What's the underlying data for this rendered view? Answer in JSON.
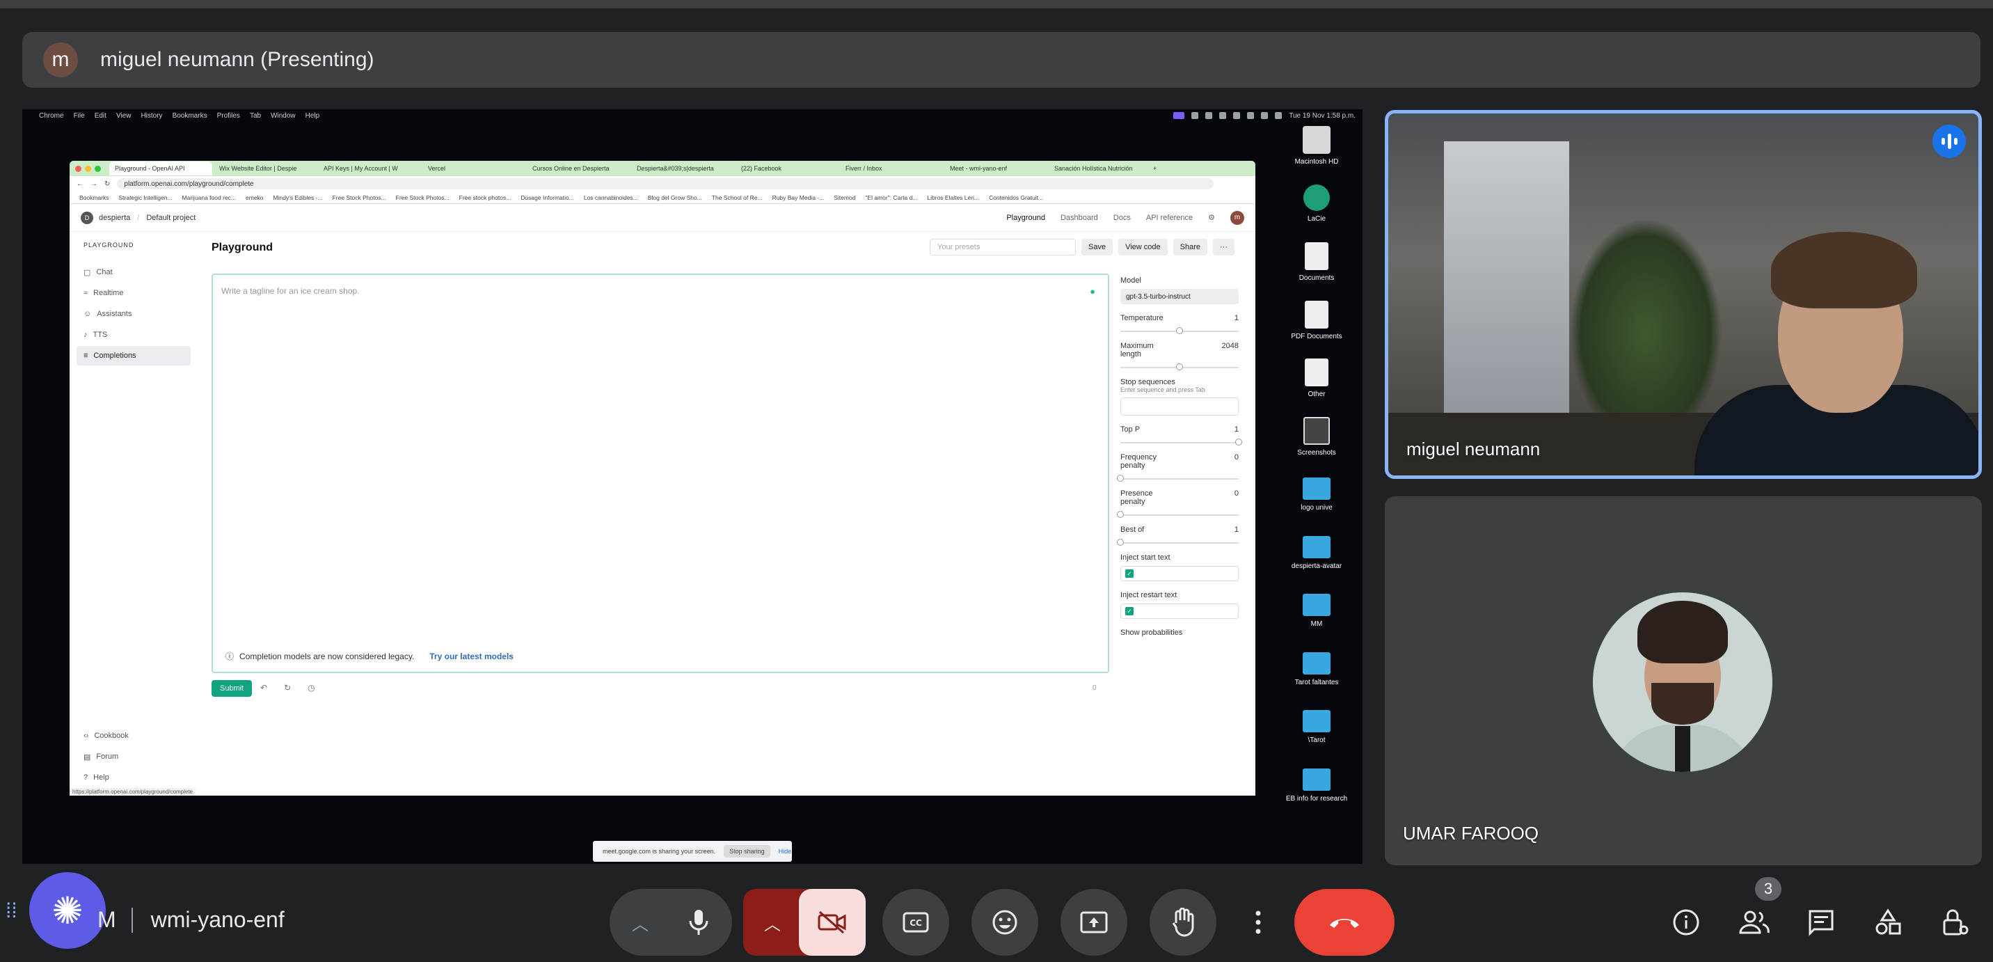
{
  "presenter": {
    "avatar_letter": "m",
    "label": "miguel neumann (Presenting)"
  },
  "mac_menu": {
    "items": [
      "Chrome",
      "File",
      "Edit",
      "View",
      "History",
      "Bookmarks",
      "Profiles",
      "Tab",
      "Window",
      "Help"
    ],
    "clock": "Tue 19 Nov  1:58 p.m."
  },
  "browser": {
    "tabs": [
      "Playground - OpenAI API",
      "Wix Website Editor | Despie",
      "API Keys | My Account | W",
      "Vercel",
      "Cursos Online en Despierta",
      "Despierta&#039;s|despierta",
      "(22) Facebook",
      "Fiverr / Inbox",
      "Meet - wmi-yano-enf",
      "Sanación Holística Nutrición"
    ],
    "url": "platform.openai.com/playground/complete",
    "bookmarks": [
      "Bookmarks",
      "Strategic Intelligen...",
      "Marijuana food rec...",
      "emeko",
      "Mindy's Edibles -...",
      "Free Stock Photos...",
      "Free Stock Photos...",
      "Free stock photos...",
      "Dosage Informatio...",
      "Los cannabinoides...",
      "Blog del Grow Sho...",
      "The School of Re...",
      "Ruby Bay Media -...",
      "Sitemod",
      "\"El amor\": Carta d...",
      "Libros Elaltes Leri...",
      "Contenidos Gratuit..."
    ],
    "status_url": "https://platform.openai.com/playground/complete"
  },
  "openai": {
    "org_badge": "D",
    "org": "despierta",
    "project": "Default project",
    "nav": [
      "Playground",
      "Dashboard",
      "Docs",
      "API reference"
    ],
    "avatar_letter": "m",
    "sidebar_heading": "PLAYGROUND",
    "sidebar_items": [
      "Chat",
      "Realtime",
      "Assistants",
      "TTS",
      "Completions"
    ],
    "sidebar_bottom": [
      "Cookbook",
      "Forum",
      "Help"
    ],
    "page_title": "Playground",
    "presets_placeholder": "Your presets",
    "buttons": {
      "save": "Save",
      "view_code": "View code",
      "share": "Share",
      "more": "···"
    },
    "editor_placeholder": "Write a tagline for an ice cream shop.",
    "legacy_notice": "Completion models are now considered legacy.",
    "legacy_link": "Try our latest models",
    "submit": "Submit",
    "token_count": "0",
    "params": {
      "model_label": "Model",
      "model_value": "gpt-3.5-turbo-instruct",
      "temperature_label": "Temperature",
      "temperature_value": "1",
      "temperature_level": 0.5,
      "max_length_label": "Maximum length",
      "max_length_value": "2048",
      "max_length_level": 0.5,
      "stop_label": "Stop sequences",
      "stop_hint": "Enter sequence and press Tab",
      "top_p_label": "Top P",
      "top_p_value": "1",
      "top_p_level": 1.0,
      "freq_label": "Frequency penalty",
      "freq_value": "0",
      "freq_level": 0.0,
      "presence_label": "Presence penalty",
      "presence_value": "0",
      "presence_level": 0.0,
      "best_of_label": "Best of",
      "best_of_value": "1",
      "best_of_level": 0.0,
      "inject_start_label": "Inject start text",
      "inject_restart_label": "Inject restart text",
      "show_prob_label": "Show probabilities"
    }
  },
  "desktop_icons": [
    "Macintosh HD",
    "LaCie",
    "Documents",
    "PDF Documents",
    "Other",
    "Screenshots",
    "logo unive",
    "despierta-avatar",
    "MM",
    "Tarot faltantes",
    "\\Tarot",
    "EB info for research"
  ],
  "share_notice": {
    "text": "meet.google.com is sharing your screen.",
    "stop": "Stop sharing",
    "hide": "Hide"
  },
  "participants": {
    "miguel": "miguel neumann",
    "umar": "UMAR FAROOQ"
  },
  "meeting": {
    "prefix": "M",
    "code": "wmi-yano-enf",
    "participant_count": "3"
  },
  "colors": {
    "accent": "#8ab4f8",
    "leave": "#ea4335",
    "fab": "#5e5ce6",
    "openai_green": "#10a37f"
  }
}
